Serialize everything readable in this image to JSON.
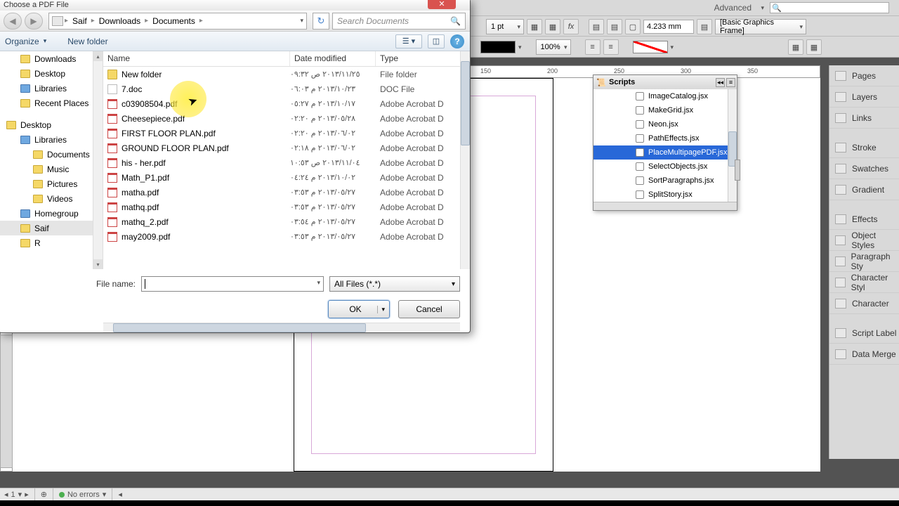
{
  "menubar": {
    "advanced": "Advanced"
  },
  "toolbar": {
    "stroke_pt": "1 pt",
    "measure": "4.233 mm",
    "frame_style": "[Basic Graphics Frame]",
    "zoom": "100%"
  },
  "dialog": {
    "title": "Choose a PDF File",
    "breadcrumb": [
      "Saif",
      "Downloads",
      "Documents"
    ],
    "search_placeholder": "Search Documents",
    "organize": "Organize",
    "new_folder": "New folder",
    "tree": [
      {
        "label": "Downloads",
        "indent": true
      },
      {
        "label": "Desktop",
        "indent": true
      },
      {
        "label": "Libraries",
        "indent": true
      },
      {
        "label": "Recent Places",
        "indent": true
      },
      {
        "spacer": true
      },
      {
        "label": "Desktop",
        "indent": false
      },
      {
        "label": "Libraries",
        "indent": true
      },
      {
        "label": "Documents",
        "indent": true,
        "deep": true
      },
      {
        "label": "Music",
        "indent": true,
        "deep": true
      },
      {
        "label": "Pictures",
        "indent": true,
        "deep": true
      },
      {
        "label": "Videos",
        "indent": true,
        "deep": true
      },
      {
        "label": "Homegroup",
        "indent": true
      },
      {
        "label": "Saif",
        "indent": true,
        "sel": true
      },
      {
        "label": "R",
        "indent": true
      }
    ],
    "columns": {
      "name": "Name",
      "date": "Date modified",
      "type": "Type"
    },
    "files": [
      {
        "name": "New folder",
        "date": "٢٠١٣/١١/٢٥ ص ٠٩:٣٢",
        "type": "File folder",
        "kind": "folder"
      },
      {
        "name": "7.doc",
        "date": "٢٠١٣/١٠/٢٣ م ٠٦:٠٣",
        "type": "DOC File",
        "kind": "doc"
      },
      {
        "name": "c03908504.pdf",
        "date": "٢٠١٣/١٠/١٧ م ٠٥:٢٧",
        "type": "Adobe Acrobat D",
        "kind": "pdf"
      },
      {
        "name": "Cheesepiece.pdf",
        "date": "٢٠١٣/٠٥/٢٨ م ٠٢:٢٠",
        "type": "Adobe Acrobat D",
        "kind": "pdf"
      },
      {
        "name": "FIRST  FLOOR PLAN.pdf",
        "date": "٢٠١٣/٠٦/٠٢ م ٠٢:٢٠",
        "type": "Adobe Acrobat D",
        "kind": "pdf"
      },
      {
        "name": "GROUND FLOOR PLAN.pdf",
        "date": "٢٠١٣/٠٦/٠٢ م ٠٢:١٨",
        "type": "Adobe Acrobat D",
        "kind": "pdf"
      },
      {
        "name": "his - her.pdf",
        "date": "٢٠١٣/١١/٠٤ ص ١٠:٥٣",
        "type": "Adobe Acrobat D",
        "kind": "pdf"
      },
      {
        "name": "Math_P1.pdf",
        "date": "٢٠١٣/١٠/٠٢ م ٠٤:٢٤",
        "type": "Adobe Acrobat D",
        "kind": "pdf"
      },
      {
        "name": "matha.pdf",
        "date": "٢٠١٣/٠٥/٢٧ م ٠٣:٥٣",
        "type": "Adobe Acrobat D",
        "kind": "pdf"
      },
      {
        "name": "mathq.pdf",
        "date": "٢٠١٣/٠٥/٢٧ م ٠٣:٥٣",
        "type": "Adobe Acrobat D",
        "kind": "pdf"
      },
      {
        "name": "mathq_2.pdf",
        "date": "٢٠١٣/٠٥/٢٧ م ٠٣:٥٤",
        "type": "Adobe Acrobat D",
        "kind": "pdf"
      },
      {
        "name": "may2009.pdf",
        "date": "٢٠١٣/٠٥/٢٧ م ٠٣:٥٣",
        "type": "Adobe Acrobat D",
        "kind": "pdf"
      }
    ],
    "file_name_label": "File name:",
    "filter": "All Files (*.*)",
    "ok": "OK",
    "cancel": "Cancel"
  },
  "scripts": {
    "title": "Scripts",
    "items": [
      "ImageCatalog.jsx",
      "MakeGrid.jsx",
      "Neon.jsx",
      "PathEffects.jsx",
      "PlaceMultipagePDF.jsx",
      "SelectObjects.jsx",
      "SortParagraphs.jsx",
      "SplitStory.jsx"
    ],
    "selected_index": 4
  },
  "rail": [
    "Pages",
    "Layers",
    "Links",
    "",
    "Stroke",
    "Swatches",
    "Gradient",
    "",
    "Effects",
    "Object Styles",
    "Paragraph Sty",
    "Character Styl",
    "Character",
    "",
    "Script Label",
    "Data Merge"
  ],
  "ruler_ticks": [
    "150",
    "200",
    "250",
    "300",
    "350"
  ],
  "status": {
    "page": "1",
    "errors": "No errors"
  }
}
